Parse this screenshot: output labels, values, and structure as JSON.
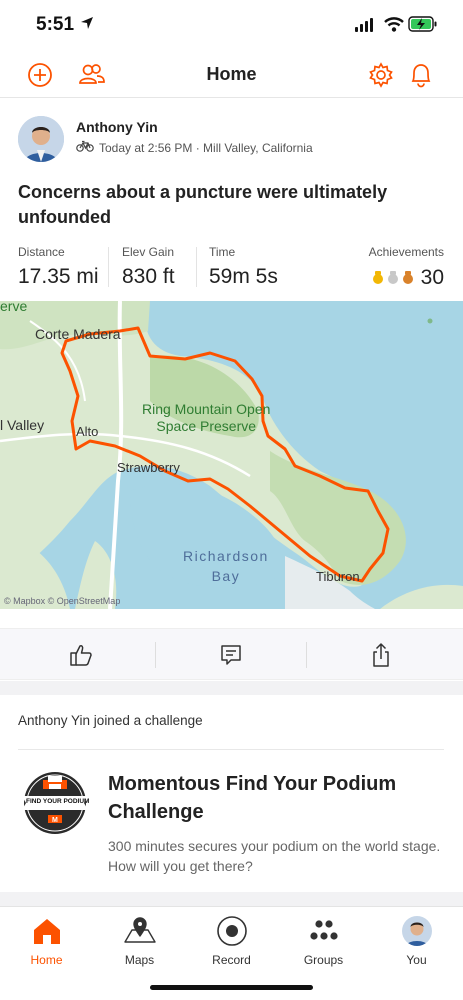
{
  "status_bar": {
    "time": "5:51"
  },
  "header": {
    "title": "Home",
    "icons": [
      "add-circle-icon",
      "friends-icon",
      "settings-gear-icon",
      "notifications-bell-icon"
    ]
  },
  "activity": {
    "athlete_name": "Anthony Yin",
    "sport_icon": "bike-icon",
    "meta": "Today at 2:56 PM · Mill Valley, California",
    "title": "Concerns about a puncture were ultimately unfounded",
    "stats": {
      "distance": {
        "label": "Distance",
        "value": "17.35 mi"
      },
      "elev_gain": {
        "label": "Elev Gain",
        "value": "830 ft"
      },
      "time": {
        "label": "Time",
        "value": "59m 5s"
      }
    },
    "achievements": {
      "label": "Achievements",
      "count": "30",
      "medal_colors": [
        "#f2b705",
        "#c8c8c8",
        "#d9822b"
      ]
    },
    "map": {
      "labels": {
        "corte_madera": "Corte Madera",
        "erve": "erve",
        "mill_valley": "l Valley",
        "alto": "Alto",
        "ring_mountain": "Ring Mountain Open\nSpace Preserve",
        "strawberry": "Strawberry",
        "richardson_bay": "Richardson\nBay",
        "tiburon": "Tiburon"
      },
      "attribution": "© Mapbox © OpenStreetMap",
      "route_color": "#fc5200"
    },
    "actions": [
      "kudos-thumbs-up-icon",
      "comment-icon",
      "share-icon"
    ]
  },
  "challenge_post": {
    "text": "Anthony Yin joined a challenge",
    "badge_text": "FIND YOUR PODIUM",
    "title": "Momentous Find Your Podium Challenge",
    "description": "300 minutes secures your podium on the world stage. How will you get there?"
  },
  "tabbar": {
    "tabs": [
      {
        "label": "Home",
        "icon": "home-icon",
        "active": true
      },
      {
        "label": "Maps",
        "icon": "map-pin-icon",
        "active": false
      },
      {
        "label": "Record",
        "icon": "record-icon",
        "active": false
      },
      {
        "label": "Groups",
        "icon": "groups-icon",
        "active": false
      },
      {
        "label": "You",
        "icon": "profile-avatar-icon",
        "active": false
      }
    ]
  },
  "colors": {
    "accent": "#fc5200",
    "text": "#222222",
    "muted": "#666666"
  }
}
